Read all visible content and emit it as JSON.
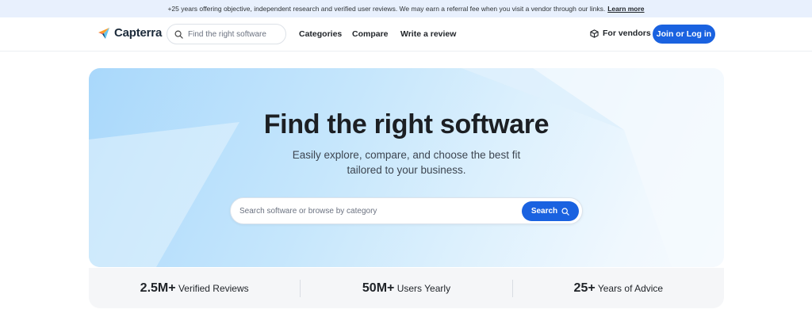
{
  "banner": {
    "text": "+25 years offering objective, independent research and verified user reviews. We may earn a referral fee when you visit a vendor through our links.",
    "link": "Learn more"
  },
  "nav": {
    "brand": "Capterra",
    "search_placeholder": "Find the right software",
    "links": [
      "Categories",
      "Compare",
      "Write a review"
    ],
    "vendors": "For vendors",
    "join": "Join or Log in"
  },
  "hero": {
    "title": "Find the right software",
    "subtitle_line1": "Easily explore, compare, and choose the best fit",
    "subtitle_line2": "tailored to your business.",
    "search_placeholder": "Search software or browse by category",
    "search_button": "Search"
  },
  "stats": [
    {
      "value": "2.5M+",
      "label": "Verified Reviews"
    },
    {
      "value": "50M+",
      "label": "Users Yearly"
    },
    {
      "value": "25+",
      "label": "Years of Advice"
    }
  ],
  "colors": {
    "accent": "#1a62e0",
    "banner_bg": "#e8f0fd",
    "hero_light": "#f0f8fe",
    "hero_blue": "#a9d8fb"
  }
}
